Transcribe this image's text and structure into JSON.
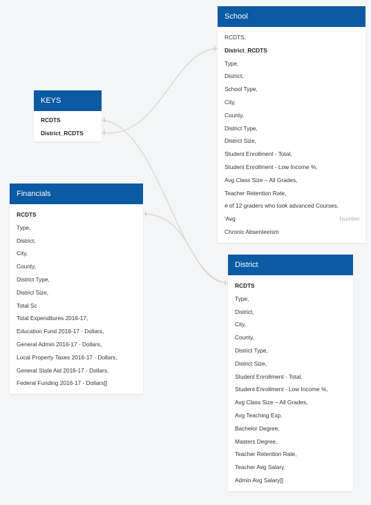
{
  "tables": {
    "keys": {
      "title": "KEYS",
      "fields": [
        "RCDTS",
        "District_RCDTS"
      ]
    },
    "school": {
      "title": "School",
      "fields": [
        "RCDTS,",
        "District_RCDTS",
        "Type,",
        "District,",
        "School Type,",
        "City,",
        "County,",
        "District Type,",
        "District Size,",
        "Student Enrollment - Total,",
        "Student Enrollment - Low Income %,",
        "Avg Class Size – All Grades,",
        "Teacher Retention Rate,",
        "# of 12 graders who took advanced Courses,",
        "'Avg",
        "Chronic Absenteeism"
      ],
      "type_annotation": "Number"
    },
    "financials": {
      "title": "Financials",
      "fields": [
        "RCDTS",
        "Type,",
        "District,",
        "City,",
        "County,",
        "District Type,",
        "District Size,",
        "Total Sc",
        "Total Expenditures 2016-17,",
        "Education Fund 2016-17 - Dollars,",
        "General Admin 2016-17 - Dollars,",
        "Local Property Taxes 2016-17 - Dollars,",
        "General State Aid 2016-17 - Dollars,",
        "Federal Funding 2016-17 - Dollars]]"
      ]
    },
    "district": {
      "title": "District",
      "fields": [
        "RCDTS",
        "Type,",
        "District,",
        "City,",
        "County,",
        "District Type,",
        "District Size,",
        "Student Enrollment - Total,",
        "Student Enrollment - Low Income %,",
        "Avg Class Size – All Grades,",
        "Avg Teaching Exp,",
        "Bachelor Degree,",
        "Masters Degree,",
        "Teacher Retention Rate,",
        "Teacher Avg Salary,",
        "Admin Avg Salary]]"
      ]
    }
  },
  "colors": {
    "header_bg": "#0b5aa4",
    "connector": "#d9d9d9",
    "canvas_bg": "#f4f5f6"
  }
}
